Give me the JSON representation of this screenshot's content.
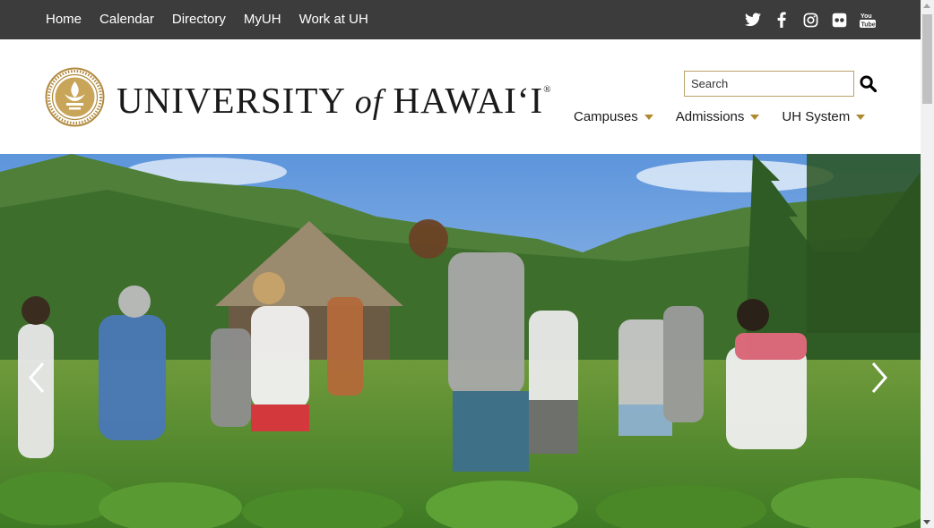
{
  "top_nav": {
    "links": [
      {
        "label": "Home"
      },
      {
        "label": "Calendar"
      },
      {
        "label": "Directory"
      },
      {
        "label": "MyUH"
      },
      {
        "label": "Work at UH"
      }
    ],
    "social_icons": [
      "twitter-icon",
      "facebook-icon",
      "instagram-icon",
      "flickr-icon",
      "youtube-icon"
    ]
  },
  "header": {
    "wordmark": {
      "part1": "UNIVERSITY",
      "part2": "of",
      "part3": "HAWAIʻI",
      "registered": "®"
    },
    "search": {
      "placeholder": "Search"
    },
    "main_nav": [
      {
        "label": "Campuses"
      },
      {
        "label": "Admissions"
      },
      {
        "label": "UH System"
      }
    ]
  },
  "hero": {
    "arrows": [
      "chevron-left-icon",
      "chevron-right-icon"
    ]
  },
  "colors": {
    "topbar": "#3c3c3c",
    "gold_accent": "#b0892f",
    "search_border": "#b9a36a"
  }
}
